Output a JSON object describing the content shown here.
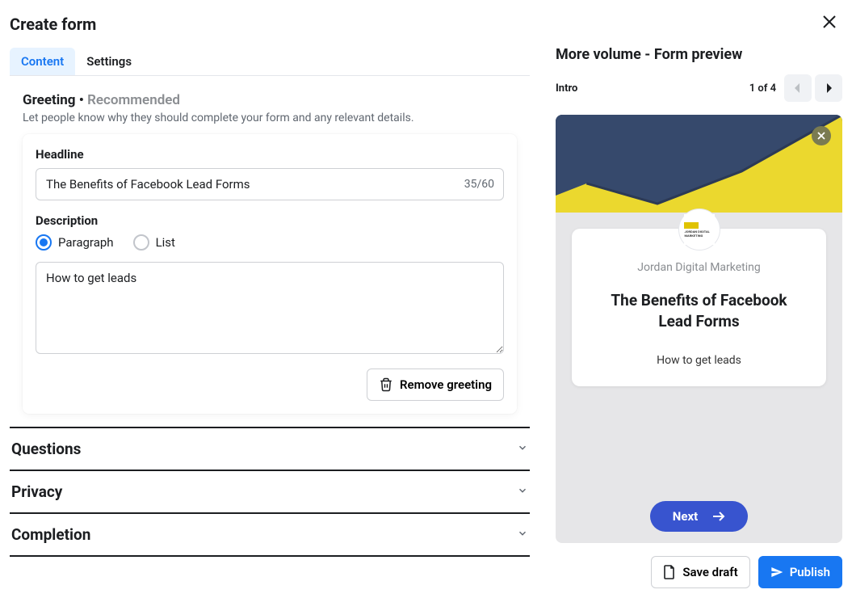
{
  "header": {
    "title": "Create form"
  },
  "tabs": {
    "content": "Content",
    "settings": "Settings"
  },
  "greeting": {
    "title": "Greeting",
    "recommended": "Recommended",
    "desc": "Let people know why they should complete your form and any relevant details.",
    "headline_label": "Headline",
    "headline_value": "The Benefits of Facebook Lead Forms",
    "headline_count": "35/60",
    "description_label": "Description",
    "option_paragraph": "Paragraph",
    "option_list": "List",
    "description_value": "How to get leads",
    "remove_label": "Remove greeting"
  },
  "accordion": {
    "questions": "Questions",
    "privacy": "Privacy",
    "completion": "Completion"
  },
  "preview": {
    "title": "More volume - Form preview",
    "step_label": "Intro",
    "page_indicator": "1 of 4",
    "brand": "Jordan Digital Marketing",
    "headline": "The Benefits of Facebook Lead Forms",
    "desc": "How to get leads",
    "next_label": "Next",
    "avatar_text": "JORDAN DIGITAL MARKETING"
  },
  "footer": {
    "save_draft": "Save draft",
    "publish": "Publish"
  },
  "colors": {
    "primary": "#1877f2",
    "preview_next": "#3854cf",
    "banner_bg": "#36496c",
    "banner_yellow": "#ebd82e"
  }
}
